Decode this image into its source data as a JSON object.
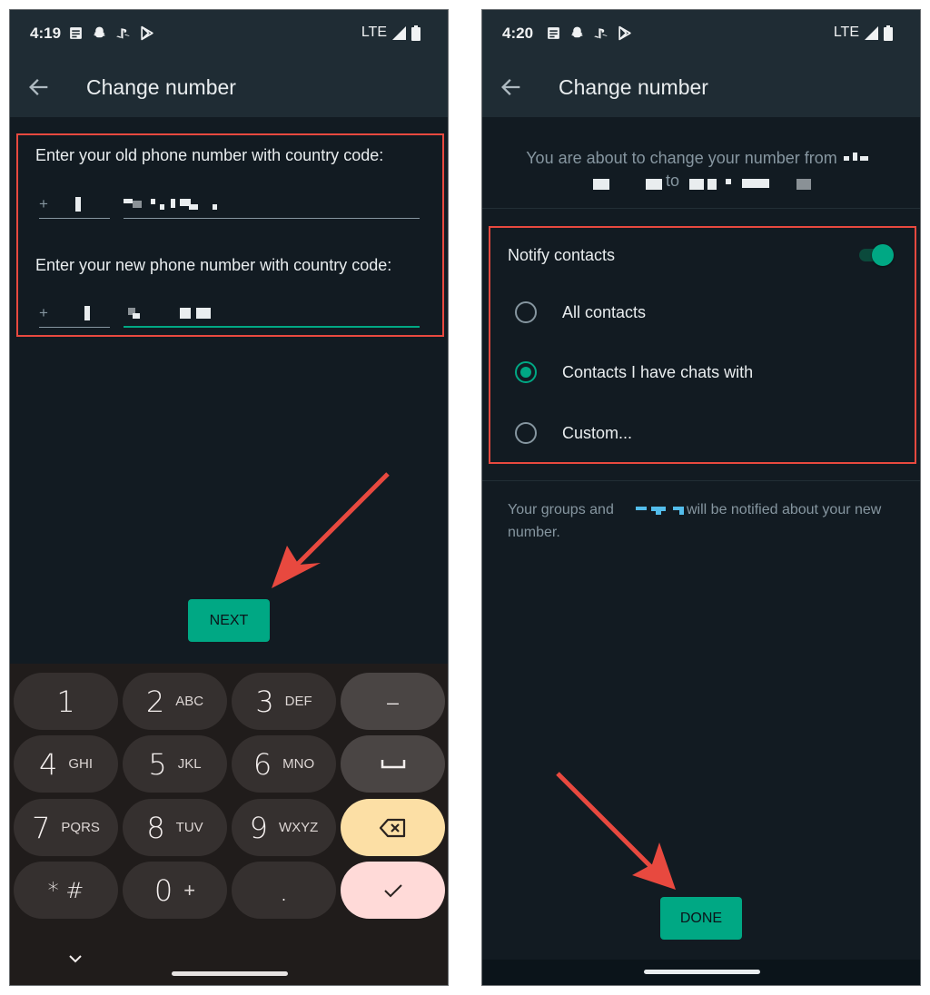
{
  "left_screen": {
    "status_bar": {
      "time": "4:19",
      "notification_icons": [
        "news-icon",
        "snapchat-icon",
        "playstation-icon",
        "play-store-icon"
      ],
      "network": "LTE",
      "signal_icon": "signal-icon",
      "battery_icon": "battery-icon"
    },
    "app_bar": {
      "back_icon": "arrow-back-icon",
      "title": "Change number"
    },
    "form": {
      "old_number_label": "Enter your old phone number with country code:",
      "old_country_code_prefix": "+",
      "new_number_label": "Enter your new phone number with country code:",
      "new_country_code_prefix": "+"
    },
    "next_button": "NEXT",
    "keyboard": {
      "keys": [
        {
          "main": "1",
          "sub": ""
        },
        {
          "main": "2",
          "sub": "ABC"
        },
        {
          "main": "3",
          "sub": "DEF"
        },
        {
          "main": "–",
          "sub": ""
        },
        {
          "main": "4",
          "sub": "GHI"
        },
        {
          "main": "5",
          "sub": "JKL"
        },
        {
          "main": "6",
          "sub": "MNO"
        },
        {
          "main": "␣",
          "sub": ""
        },
        {
          "main": "7",
          "sub": "PQRS"
        },
        {
          "main": "8",
          "sub": "TUV"
        },
        {
          "main": "9",
          "sub": "WXYZ"
        },
        {
          "main": "⌫",
          "sub": ""
        },
        {
          "main": "* #",
          "sub": ""
        },
        {
          "main": "0",
          "sub": "+"
        },
        {
          "main": ".",
          "sub": ""
        },
        {
          "main": "✓",
          "sub": ""
        }
      ],
      "collapse_icon": "chevron-down-icon"
    }
  },
  "right_screen": {
    "status_bar": {
      "time": "4:20",
      "notification_icons": [
        "news-icon",
        "snapchat-icon",
        "playstation-icon",
        "play-store-icon"
      ],
      "network": "LTE",
      "signal_icon": "signal-icon",
      "battery_icon": "battery-icon"
    },
    "app_bar": {
      "back_icon": "arrow-back-icon",
      "title": "Change number"
    },
    "description_prefix": "You are about to change your number from",
    "description_to": "to",
    "notify": {
      "label": "Notify contacts",
      "enabled": true,
      "options": [
        {
          "label": "All contacts",
          "selected": false
        },
        {
          "label": "Contacts I have chats with",
          "selected": true
        },
        {
          "label": "Custom...",
          "selected": false
        }
      ]
    },
    "info_prefix": "Your groups and",
    "info_suffix": "will be notified about your new",
    "info_line2": "number.",
    "done_button": "DONE"
  },
  "colors": {
    "accent": "#00a884",
    "annotation": "#e8493f",
    "background": "#121b22",
    "app_bar": "#1f2c34",
    "keyboard_bg": "#201c1b",
    "delete_key": "#fcdfa5",
    "confirm_key": "#ffdad8"
  }
}
